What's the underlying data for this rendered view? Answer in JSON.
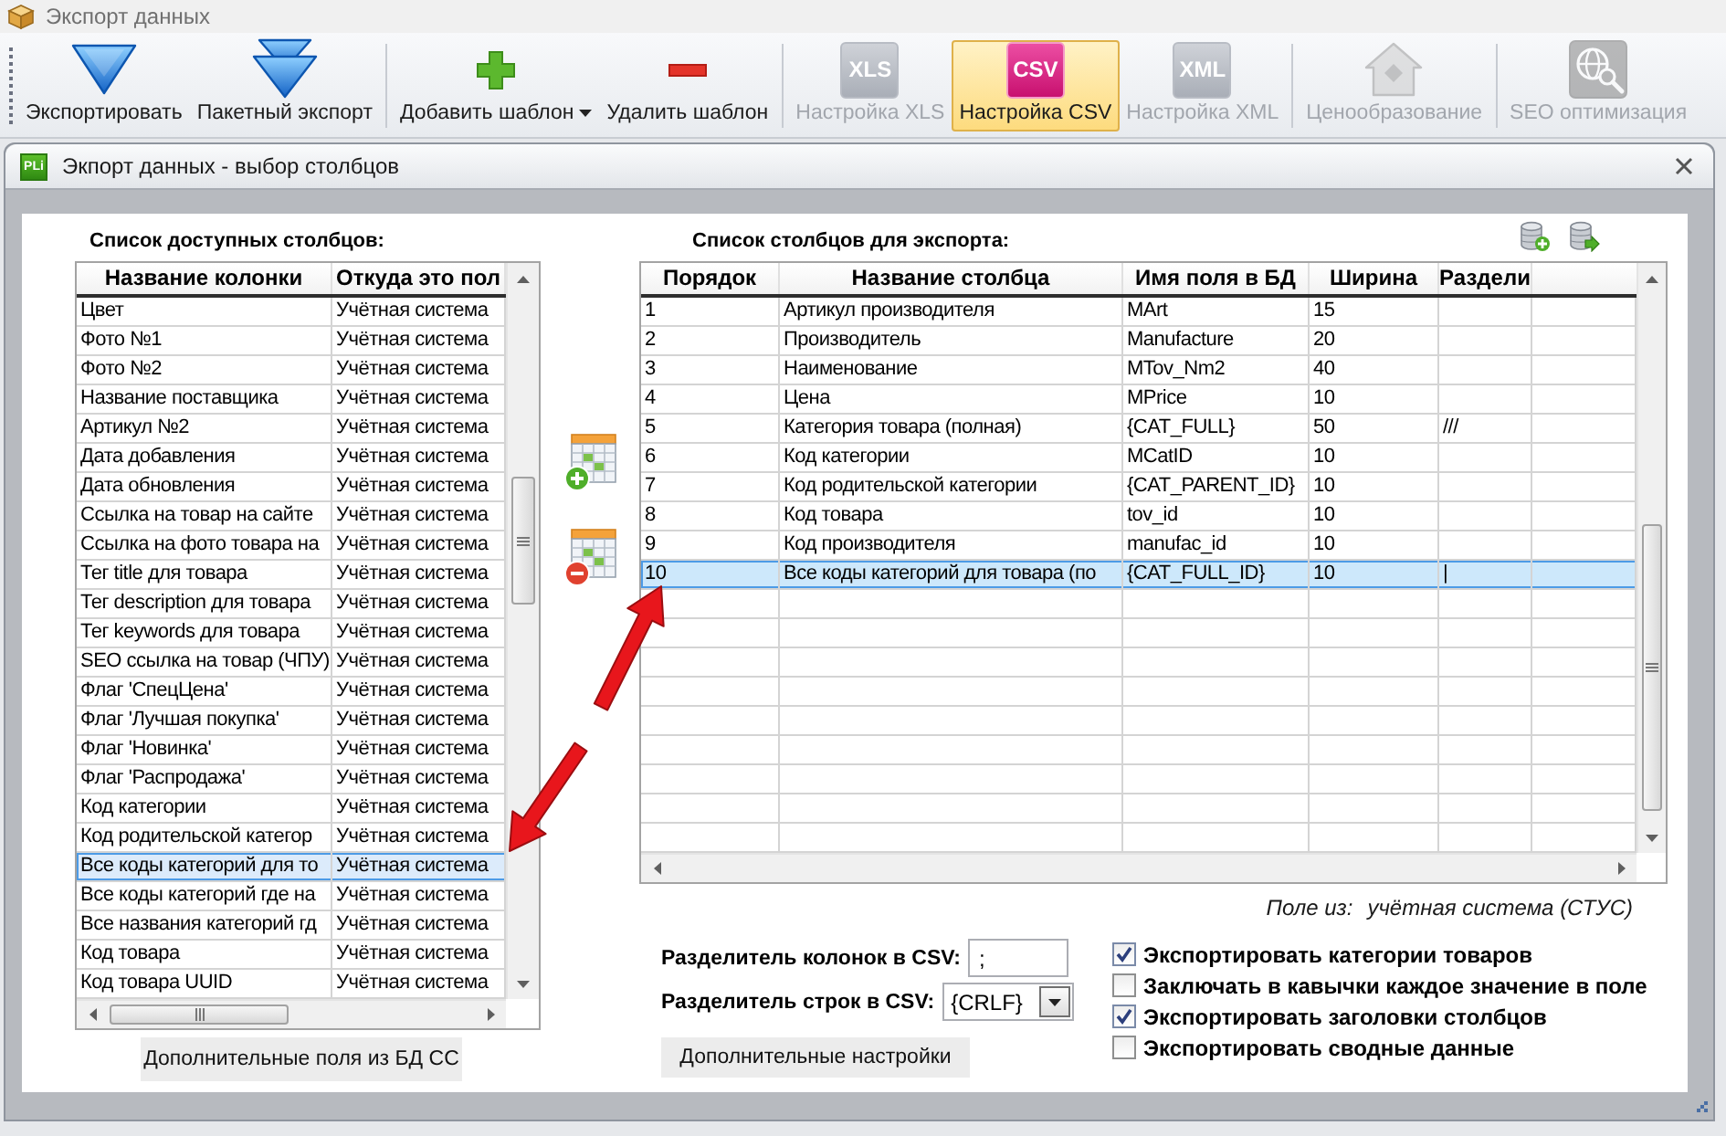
{
  "window": {
    "title": "Экспорт данных"
  },
  "toolbar": {
    "groups": [
      {
        "buttons": [
          {
            "kind": "export",
            "label": "Экспортировать",
            "disabled": false,
            "selected": false,
            "dropdown": false
          },
          {
            "kind": "batch-export",
            "label": "Пакетный экспорт",
            "disabled": false,
            "selected": false,
            "dropdown": false
          }
        ]
      },
      {
        "buttons": [
          {
            "kind": "add",
            "label": "Добавить шаблон",
            "disabled": false,
            "selected": false,
            "dropdown": true
          },
          {
            "kind": "remove",
            "label": "Удалить шаблон",
            "disabled": false,
            "selected": false,
            "dropdown": false
          }
        ]
      },
      {
        "buttons": [
          {
            "kind": "format",
            "tile_text": "XLS",
            "label": "Настройка XLS",
            "disabled": true,
            "selected": false,
            "dropdown": false
          },
          {
            "kind": "format",
            "tile_text": "CSV",
            "label": "Настройка CSV",
            "disabled": false,
            "selected": true,
            "dropdown": false
          },
          {
            "kind": "format",
            "tile_text": "XML",
            "label": "Настройка XML",
            "disabled": true,
            "selected": false,
            "dropdown": false
          }
        ]
      },
      {
        "buttons": [
          {
            "kind": "pricing",
            "label": "Ценообразование",
            "disabled": true,
            "selected": false,
            "dropdown": false
          }
        ]
      },
      {
        "buttons": [
          {
            "kind": "seo",
            "label": "SEO оптимизация",
            "disabled": true,
            "selected": false,
            "dropdown": false
          }
        ]
      }
    ]
  },
  "dialog": {
    "logo_text": "PLi",
    "title": "Экпорт данных - выбор столбцов"
  },
  "available_columns": {
    "title": "Список доступных столбцов:",
    "columns": [
      "Название колонки",
      "Откуда это пол"
    ],
    "rows": [
      {
        "cells": [
          "Цвет",
          "Учётная система"
        ],
        "selected": false
      },
      {
        "cells": [
          "Фото №1",
          "Учётная система"
        ],
        "selected": false
      },
      {
        "cells": [
          "Фото №2",
          "Учётная система"
        ],
        "selected": false
      },
      {
        "cells": [
          "Название поставщика",
          "Учётная система"
        ],
        "selected": false
      },
      {
        "cells": [
          "Артикул №2",
          "Учётная система"
        ],
        "selected": false
      },
      {
        "cells": [
          "Дата добавления",
          "Учётная система"
        ],
        "selected": false
      },
      {
        "cells": [
          "Дата обновления",
          "Учётная система"
        ],
        "selected": false
      },
      {
        "cells": [
          "Ссылка на товар на сайте",
          "Учётная система"
        ],
        "selected": false
      },
      {
        "cells": [
          "Ссылка на фото товара на",
          "Учётная система"
        ],
        "selected": false
      },
      {
        "cells": [
          "Тег title для товара",
          "Учётная система"
        ],
        "selected": false
      },
      {
        "cells": [
          "Тег description для товара",
          "Учётная система"
        ],
        "selected": false
      },
      {
        "cells": [
          "Тег keywords для товара",
          "Учётная система"
        ],
        "selected": false
      },
      {
        "cells": [
          "SEO ссылка на товар (ЧПУ)",
          "Учётная система"
        ],
        "selected": false
      },
      {
        "cells": [
          "Флаг 'СпецЦена'",
          "Учётная система"
        ],
        "selected": false
      },
      {
        "cells": [
          "Флаг 'Лучшая покупка'",
          "Учётная система"
        ],
        "selected": false
      },
      {
        "cells": [
          "Флаг 'Новинка'",
          "Учётная система"
        ],
        "selected": false
      },
      {
        "cells": [
          "Флаг 'Распродажа'",
          "Учётная система"
        ],
        "selected": false
      },
      {
        "cells": [
          "Код категории",
          "Учётная система"
        ],
        "selected": false
      },
      {
        "cells": [
          "Код родительской категор",
          "Учётная система"
        ],
        "selected": false
      },
      {
        "cells": [
          "Все коды категорий для то",
          "Учётная система"
        ],
        "selected": true
      },
      {
        "cells": [
          "Все коды категорий где на",
          "Учётная система"
        ],
        "selected": false
      },
      {
        "cells": [
          "Все названия категорий гд",
          "Учётная система"
        ],
        "selected": false
      },
      {
        "cells": [
          "Код товара",
          "Учётная система"
        ],
        "selected": false
      },
      {
        "cells": [
          "Код товара UUID",
          "Учётная система"
        ],
        "selected": false
      }
    ]
  },
  "available_columns_button": "Дополнительные поля из БД СС",
  "export_columns": {
    "title": "Список столбцов для экспорта:",
    "columns": [
      "Порядок",
      "Название столбца",
      "Имя поля в БД",
      "Ширина",
      "Раздели"
    ],
    "rows": [
      {
        "cells": [
          "1",
          "Артикул производителя",
          "MArt",
          "15"
        ],
        "selected": false
      },
      {
        "cells": [
          "2",
          "Производитель",
          "Manufacture",
          "20"
        ],
        "selected": false
      },
      {
        "cells": [
          "3",
          "Наименование",
          "MTov_Nm2",
          "40"
        ],
        "selected": false
      },
      {
        "cells": [
          "4",
          "Цена",
          "MPrice",
          "10"
        ],
        "selected": false
      },
      {
        "cells": [
          "5",
          "Категория товара (полная)",
          "{CAT_FULL}",
          "50",
          "///"
        ],
        "selected": false
      },
      {
        "cells": [
          "6",
          "Код категории",
          "MCatID",
          "10"
        ],
        "selected": false
      },
      {
        "cells": [
          "7",
          "Код родительской категории",
          "{CAT_PARENT_ID}",
          "10"
        ],
        "selected": false
      },
      {
        "cells": [
          "8",
          "Код товара",
          "tov_id",
          "10"
        ],
        "selected": false
      },
      {
        "cells": [
          "9",
          "Код производителя",
          "manufac_id",
          "10"
        ],
        "selected": false
      },
      {
        "cells": [
          "10",
          "Все коды категорий для товара (по",
          "{CAT_FULL_ID}",
          "10",
          "|"
        ],
        "selected": true
      }
    ]
  },
  "field_source": {
    "label": "Поле из:",
    "value": "учётная система (СТУС)"
  },
  "column_separator": {
    "label": "Разделитель колонок в CSV:",
    "value": ";"
  },
  "row_separator": {
    "label": "Разделитель строк в CSV:",
    "value": "{CRLF}"
  },
  "extra_settings_button": "Дополнительные настройки",
  "options": [
    {
      "label": "Экспортировать категории товаров",
      "checked": true
    },
    {
      "label": "Заключать в кавычки каждое значение в поле",
      "checked": false
    },
    {
      "label": "Экспортировать заголовки столбцов",
      "checked": true
    },
    {
      "label": "Экспортировать сводные данные",
      "checked": false
    }
  ]
}
